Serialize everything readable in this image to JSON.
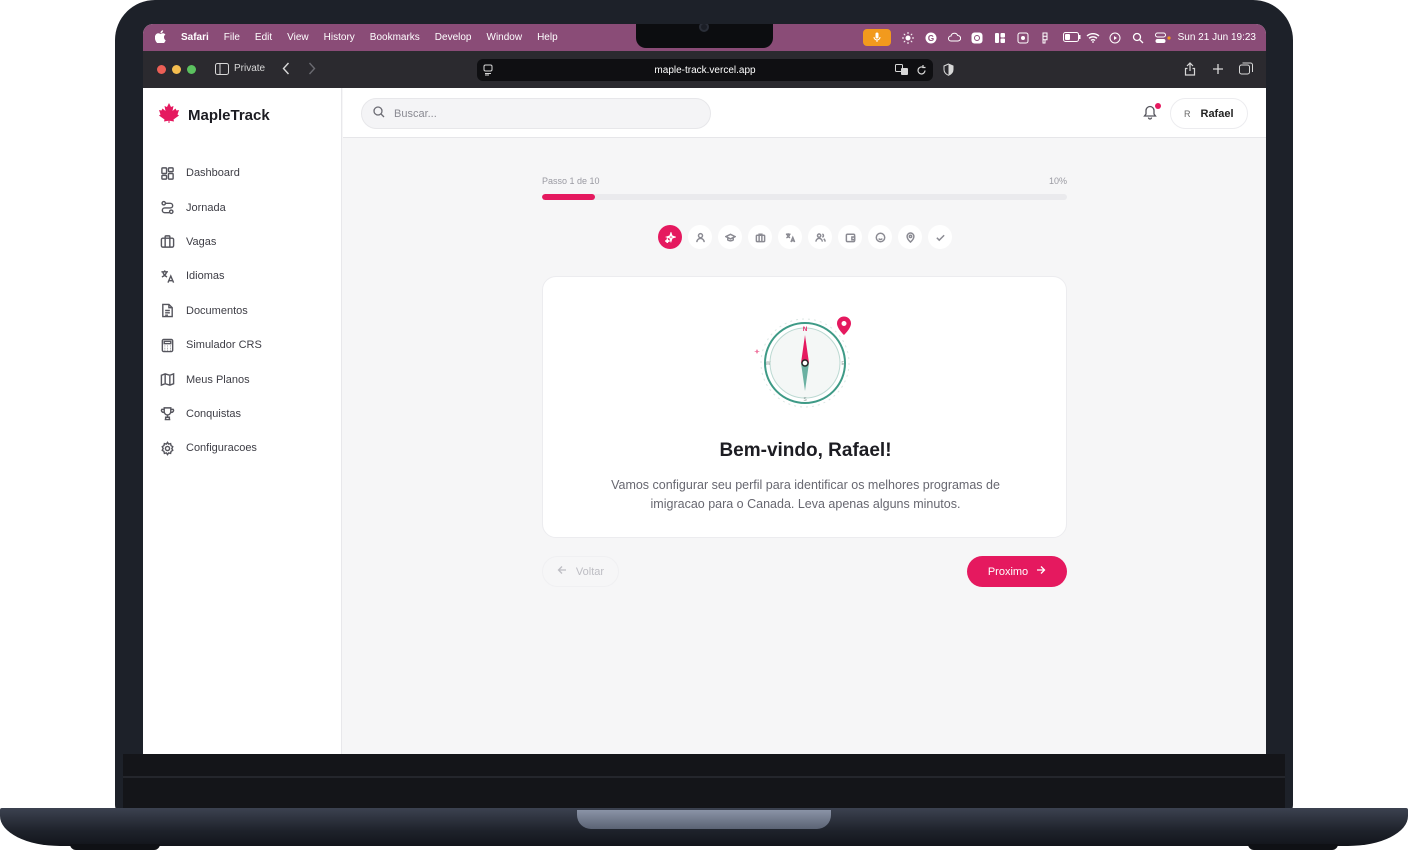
{
  "menubar": {
    "app": "Safari",
    "items": [
      "File",
      "Edit",
      "View",
      "History",
      "Bookmarks",
      "Develop",
      "Window",
      "Help"
    ],
    "datetime": "Sun 21 Jun  19:23"
  },
  "browser": {
    "private_label": "Private",
    "url": "maple-track.vercel.app"
  },
  "brand": {
    "name": "MapleTrack",
    "color": "#e5195f"
  },
  "sidebar": {
    "items": [
      {
        "label": "Dashboard",
        "icon": "dashboard-icon"
      },
      {
        "label": "Jornada",
        "icon": "route-icon"
      },
      {
        "label": "Vagas",
        "icon": "briefcase-icon"
      },
      {
        "label": "Idiomas",
        "icon": "translate-icon"
      },
      {
        "label": "Documentos",
        "icon": "document-icon"
      },
      {
        "label": "Simulador CRS",
        "icon": "calculator-icon"
      },
      {
        "label": "Meus Planos",
        "icon": "map-icon"
      },
      {
        "label": "Conquistas",
        "icon": "trophy-icon"
      },
      {
        "label": "Configuracoes",
        "icon": "gear-icon"
      }
    ]
  },
  "header": {
    "search_placeholder": "Buscar...",
    "user_initial": "R",
    "user_name": "Rafael"
  },
  "wizard": {
    "step_label": "Passo 1 de 10",
    "percent_label": "10%",
    "progress": 0.1,
    "steps": [
      "sparkles-icon",
      "user-icon",
      "graduation-cap-icon",
      "briefcase-icon",
      "translate-icon",
      "users-icon",
      "wallet-icon",
      "smile-icon",
      "location-pin-icon",
      "check-icon"
    ],
    "title": "Bem-vindo, Rafael!",
    "description": "Vamos configurar seu perfil para identificar os melhores programas de imigracao para o Canada. Leva apenas alguns minutos.",
    "back_label": "Voltar",
    "next_label": "Proximo"
  }
}
